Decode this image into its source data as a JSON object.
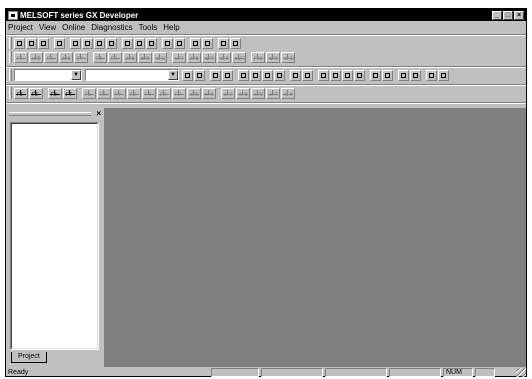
{
  "window": {
    "title": "MELSOFT series GX Developer",
    "minimize_label": "_",
    "restore_label": "□",
    "close_label": "×"
  },
  "menu": [
    "Project",
    "View",
    "Online",
    "Diagnostics",
    "Tools",
    "Help"
  ],
  "toolbars": {
    "standard": [
      "new-icon",
      "open-icon",
      "save-icon",
      "print-icon",
      "cut-icon",
      "copy-icon",
      "paste-icon",
      "undo-icon",
      "find-icon",
      "replace-icon",
      "device-search-icon",
      "write-icon",
      "read-icon",
      "monitor-icon",
      "monitor-stop-icon",
      "program-switch-icon",
      "ladder-switch-icon"
    ],
    "ladder_symbols": [
      {
        "icon": "contact-open-icon",
        "key": "F5"
      },
      {
        "icon": "contact-open-parallel-icon",
        "key": "sF5"
      },
      {
        "icon": "contact-closed-icon",
        "key": "F6"
      },
      {
        "icon": "contact-closed-parallel-icon",
        "key": "sF6"
      },
      {
        "icon": "coil-icon",
        "key": "F7"
      },
      {
        "icon": "application-instruction-icon",
        "key": "F8"
      },
      {
        "icon": "horizontal-line-icon",
        "key": "F9"
      },
      {
        "icon": "vertical-line-icon",
        "key": "sF9"
      },
      {
        "icon": "delete-horizontal-icon",
        "key": "cF9"
      },
      {
        "icon": "delete-vertical-icon",
        "key": "cF10"
      },
      {
        "icon": "rising-pulse-icon",
        "key": "sF7"
      },
      {
        "icon": "falling-pulse-icon",
        "key": "sF8"
      },
      {
        "icon": "rising-pulse-parallel-icon",
        "key": "aF7"
      },
      {
        "icon": "falling-pulse-parallel-icon",
        "key": "aF8"
      },
      {
        "icon": "invert-icon",
        "key": "caF10"
      },
      {
        "icon": "line-draw-icon",
        "key": "F10"
      },
      {
        "icon": "line-delete-icon",
        "key": "aF9"
      },
      {
        "icon": "operation-result-icon",
        "key": "aF10"
      }
    ],
    "program_combo_value": "",
    "device_combo_value": "",
    "row3_icons": [
      "device-batch-icon",
      "comment-icon",
      "statement-icon",
      "note-icon",
      "alias-icon",
      "trace-icon",
      "entry-icon",
      "test-icon",
      "step-icon",
      "skip-icon",
      "partial-icon",
      "monitor-all-icon",
      "read-mode-icon",
      "write-mode-icon",
      "comment-display-icon",
      "device-list-icon",
      "timing-icon",
      "sfc-icon",
      "zoom-icon",
      "column-icon"
    ],
    "sfc_symbols": [
      {
        "icon": "sfc-step-icon",
        "key": "F5"
      },
      {
        "icon": "sfc-block-start-icon",
        "key": "F6"
      },
      {
        "icon": "sfc-end-step-icon",
        "key": "F8"
      },
      {
        "icon": "sfc-dummy-step-icon",
        "key": "F7"
      },
      {
        "icon": "sfc-transition-icon",
        "key": "F5"
      },
      {
        "icon": "sfc-selective-branch-icon",
        "key": "F6"
      },
      {
        "icon": "sfc-parallel-branch-icon",
        "key": "F7"
      },
      {
        "icon": "sfc-selective-coupling-icon",
        "key": "F8"
      },
      {
        "icon": "sfc-parallel-coupling-icon",
        "key": "F9"
      },
      {
        "icon": "sfc-jump-icon",
        "key": "F8"
      },
      {
        "icon": "sfc-vertical-line-icon",
        "key": "F9"
      },
      {
        "icon": "sfc-selection-icon",
        "key": "sF5"
      },
      {
        "icon": "sfc-parallel-icon",
        "key": "sF6"
      },
      {
        "icon": "sfc-coupling-icon",
        "key": "sF7"
      },
      {
        "icon": "sfc-line-icon",
        "key": "sF8"
      },
      {
        "icon": "sfc-delete-line-icon",
        "key": "aF9"
      },
      {
        "icon": "sfc-mark-icon",
        "key": "aF7"
      },
      {
        "icon": "sfc-unmark-icon",
        "key": "aF8"
      }
    ]
  },
  "project_pane": {
    "tab_label": "Project",
    "close_label": "×"
  },
  "status": {
    "text": "Ready",
    "num_label": "NUM"
  }
}
